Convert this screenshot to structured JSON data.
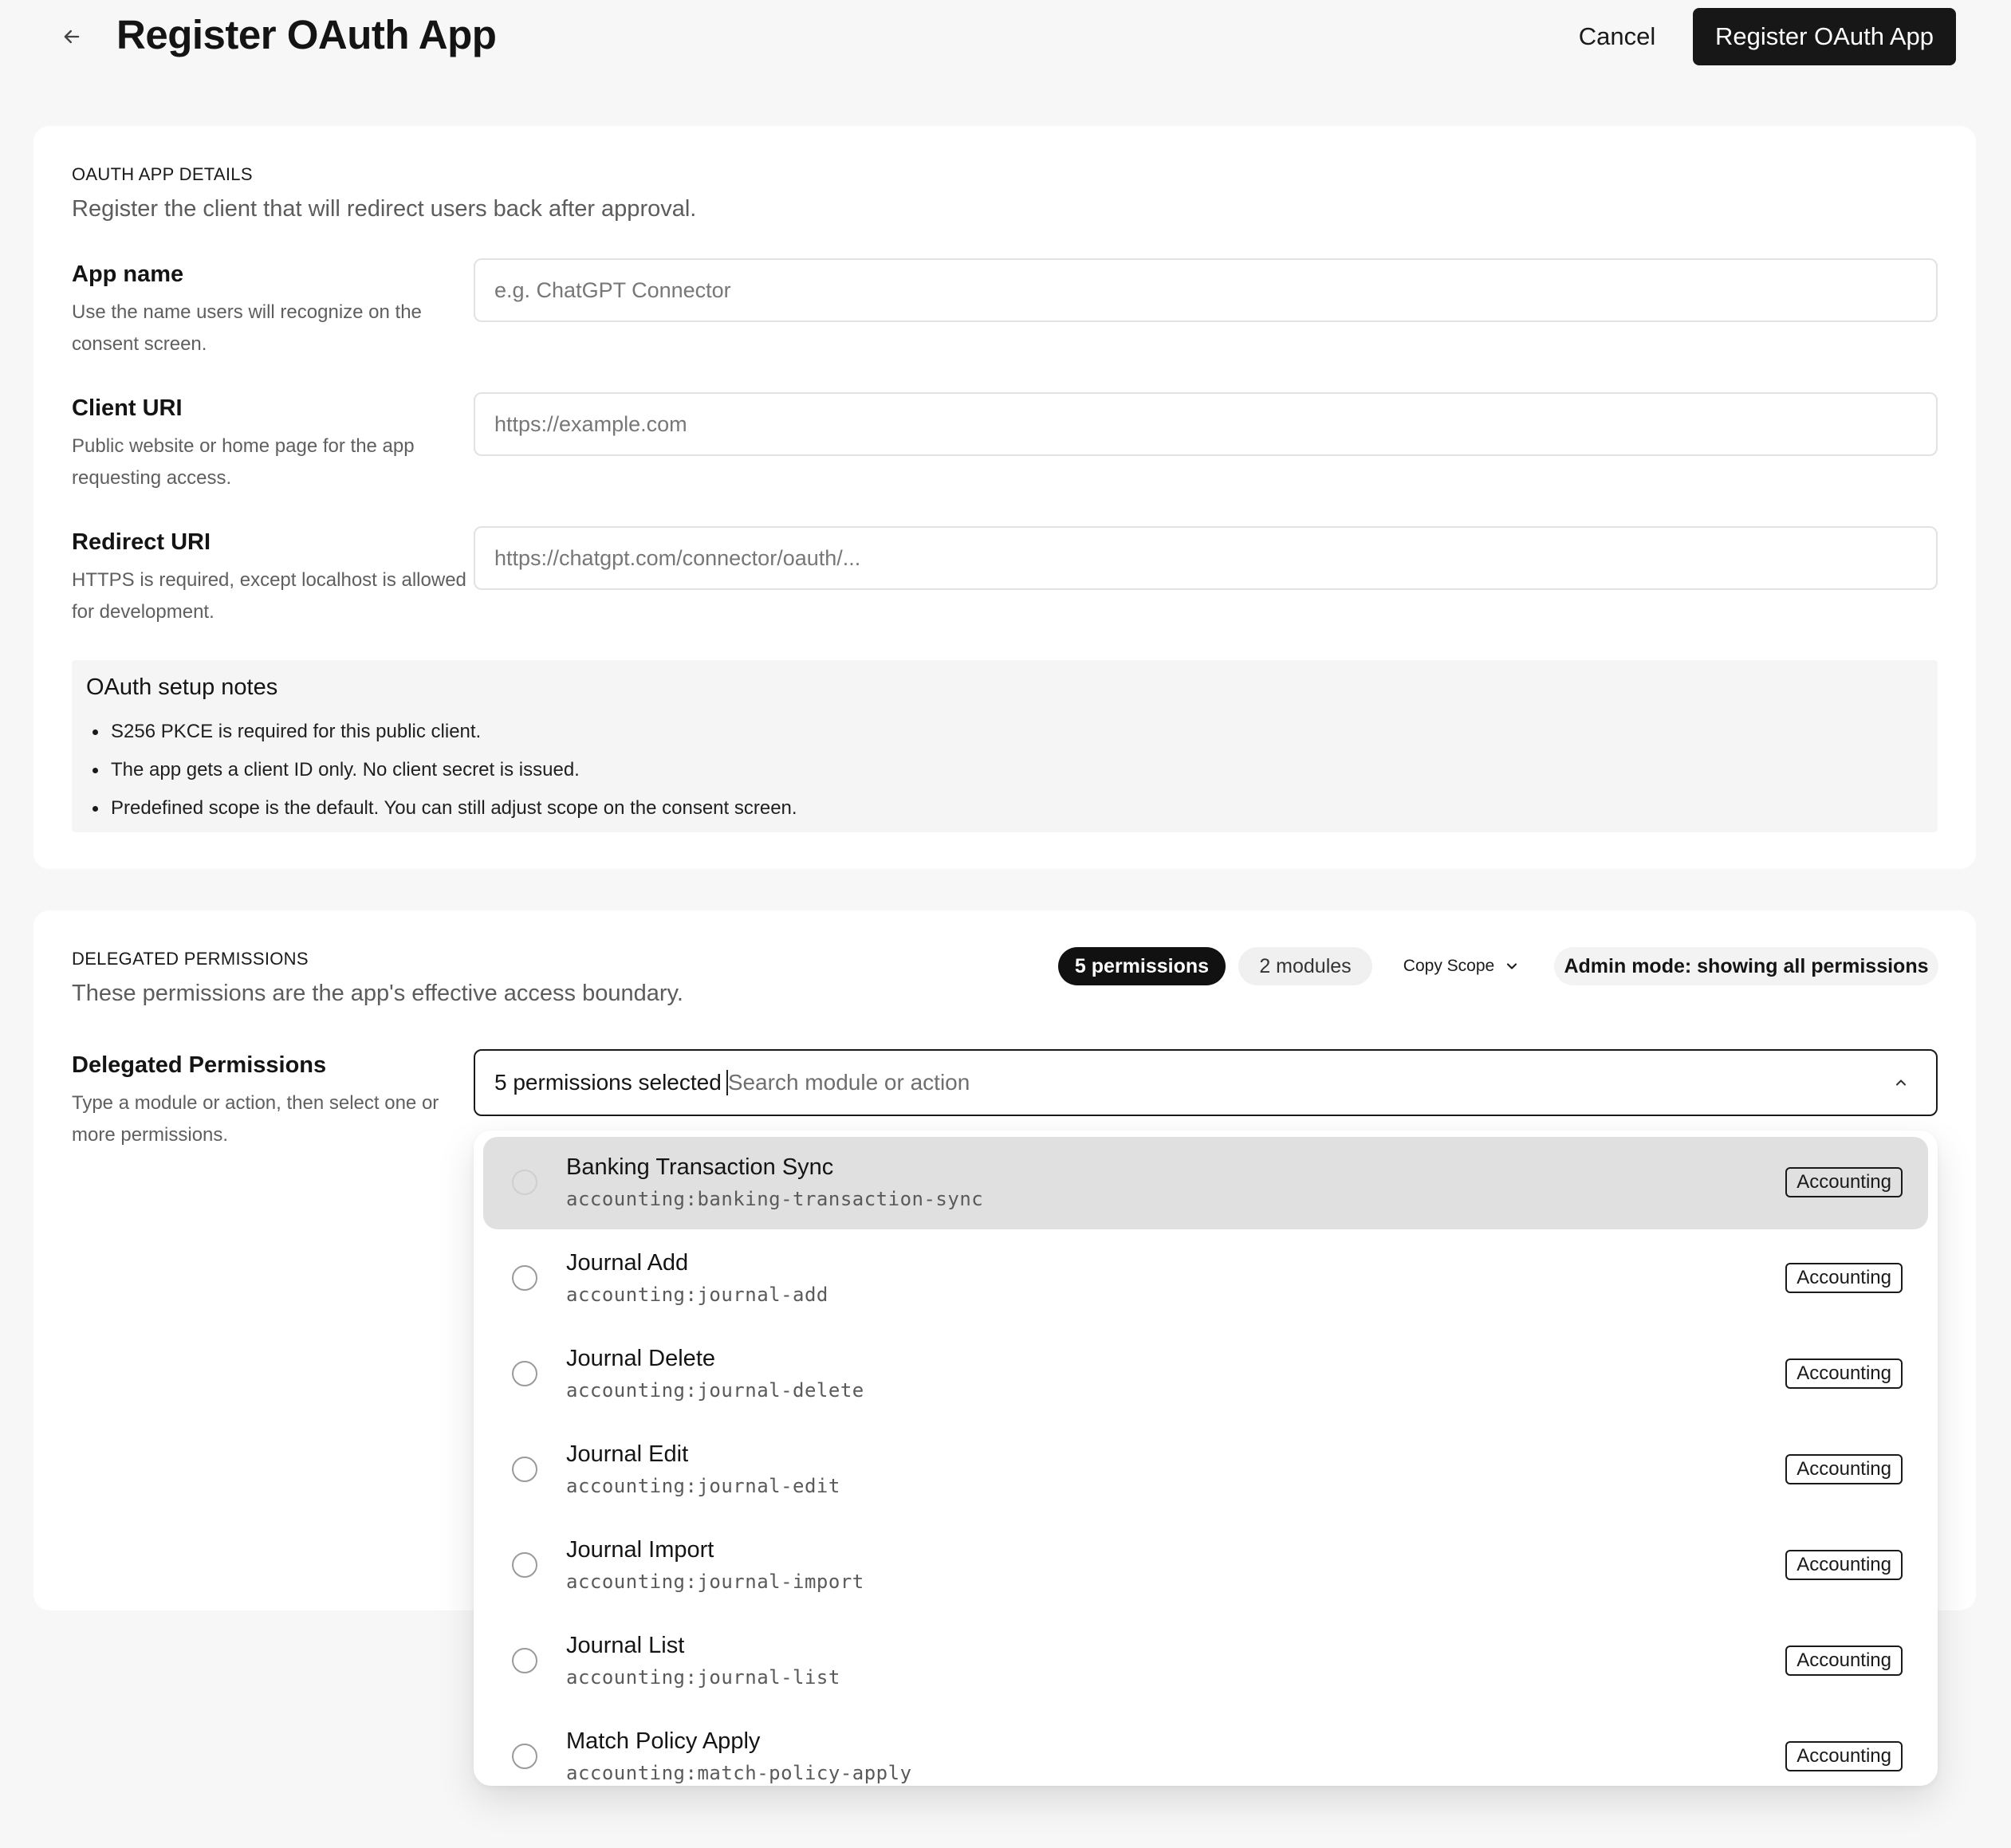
{
  "header": {
    "title": "Register OAuth App",
    "cancel_label": "Cancel",
    "register_label": "Register OAuth App"
  },
  "details": {
    "section_label": "OAUTH APP DETAILS",
    "section_desc": "Register the client that will redirect users back after approval.",
    "fields": [
      {
        "label": "App name",
        "help": "Use the name users will recognize on the consent screen.",
        "placeholder": "e.g. ChatGPT Connector",
        "value": ""
      },
      {
        "label": "Client URI",
        "help": "Public website or home page for the app requesting access.",
        "placeholder": "https://example.com",
        "value": ""
      },
      {
        "label": "Redirect URI",
        "help": "HTTPS is required, except localhost is allowed for development.",
        "placeholder": "https://chatgpt.com/connector/oauth/...",
        "value": ""
      }
    ],
    "notes": {
      "title": "OAuth setup notes",
      "items": [
        "S256 PKCE is required for this public client.",
        "The app gets a client ID only. No client secret is issued.",
        "Predefined scope is the default. You can still adjust scope on the consent screen."
      ]
    }
  },
  "permissions": {
    "section_label": "DELEGATED PERMISSIONS",
    "section_desc": "These permissions are the app's effective access boundary.",
    "permissions_count": "5 permissions",
    "modules_count": "2 modules",
    "copy_scope_label": "Copy Scope",
    "admin_mode_label": "Admin mode: showing all permissions",
    "field_label": "Delegated Permissions",
    "field_help": "Type a module or action, then select one or more permissions.",
    "selected_summary": "5 permissions selected",
    "search_placeholder": "Search module or action",
    "options": [
      {
        "title": "Banking Transaction Sync",
        "code": "accounting:banking-transaction-sync",
        "tag": "Accounting",
        "highlighted": true
      },
      {
        "title": "Journal Add",
        "code": "accounting:journal-add",
        "tag": "Accounting"
      },
      {
        "title": "Journal Delete",
        "code": "accounting:journal-delete",
        "tag": "Accounting"
      },
      {
        "title": "Journal Edit",
        "code": "accounting:journal-edit",
        "tag": "Accounting"
      },
      {
        "title": "Journal Import",
        "code": "accounting:journal-import",
        "tag": "Accounting"
      },
      {
        "title": "Journal List",
        "code": "accounting:journal-list",
        "tag": "Accounting"
      },
      {
        "title": "Match Policy Apply",
        "code": "accounting:match-policy-apply",
        "tag": "Accounting"
      }
    ]
  },
  "icons": {
    "back": "arrow-left-icon",
    "copy_scope": "chevron-down-icon",
    "combo": "chevron-up-icon"
  },
  "colors": {
    "primary": "#171717",
    "background": "#f7f7f7",
    "card": "#ffffff",
    "highlight": "#e0e0e0"
  }
}
